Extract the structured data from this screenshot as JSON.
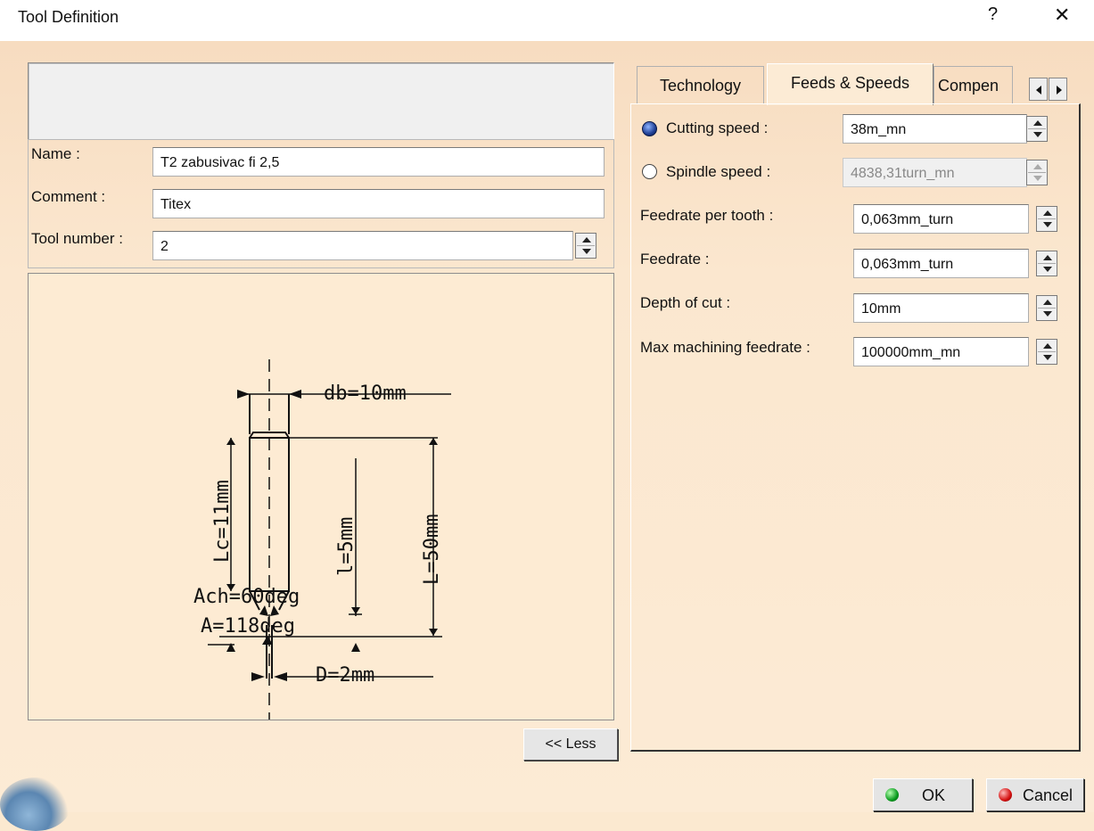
{
  "window": {
    "title": "Tool Definition",
    "help_glyph": "?",
    "close_glyph": "✕"
  },
  "tool": {
    "name_label": "Name :",
    "name_value": "T2 zabusivac fi 2,5",
    "comment_label": "Comment :",
    "comment_value": "Titex",
    "number_label": "Tool number :",
    "number_value": "2"
  },
  "drawing": {
    "db": "db=10mm",
    "lc": "Lc=11mm",
    "l": "l=5mm",
    "L": "L=50mm",
    "ach": "Ach=60deg",
    "a": "A=118deg",
    "d": "D=2mm"
  },
  "less_button": "<< Less",
  "tabs": {
    "technology": "Technology",
    "feeds": "Feeds & Speeds",
    "compensation": "Compen"
  },
  "feeds": {
    "cutting_speed_label": "Cutting speed :",
    "cutting_speed_value": "38m_mn",
    "spindle_speed_label": "Spindle speed :",
    "spindle_speed_value": "4838,31turn_mn",
    "feed_tooth_label": "Feedrate per tooth :",
    "feed_tooth_value": "0,063mm_turn",
    "feedrate_label": "Feedrate :",
    "feedrate_value": "0,063mm_turn",
    "depth_label": "Depth of cut :",
    "depth_value": "10mm",
    "max_feed_label": "Max machining feedrate :",
    "max_feed_value": "100000mm_mn",
    "selected_mode": "Cutting speed"
  },
  "buttons": {
    "ok": "OK",
    "cancel": "Cancel"
  },
  "icons": {
    "ok": "green-dot-icon",
    "cancel": "red-dot-icon",
    "tab_left": "arrow-left-icon",
    "tab_right": "arrow-right-icon",
    "radio_selected": "radio-selected-icon"
  },
  "colors": {
    "dialog_bg": "#fbe7cf",
    "drawing_bg": "#fdebd3",
    "radio_on": "#1f3f95",
    "ok_dot": "#0a9a1e",
    "cancel_dot": "#d41010"
  }
}
